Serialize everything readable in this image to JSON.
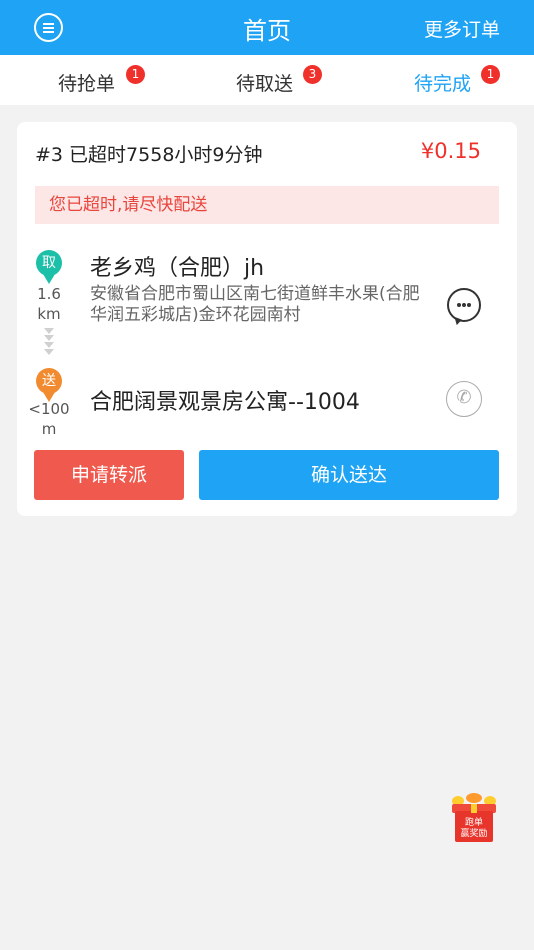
{
  "header": {
    "title": "首页",
    "more_orders": "更多订单"
  },
  "tabs": [
    {
      "label": "待抢单",
      "count": "1"
    },
    {
      "label": "待取送",
      "count": "3"
    },
    {
      "label": "待完成",
      "count": "1"
    }
  ],
  "order": {
    "info": "#3 已超时7558小时9分钟",
    "price": "¥0.15",
    "warning": "您已超时,请尽快配送",
    "pickup": {
      "tag": "取",
      "distance_value": "1.6",
      "distance_unit": "km",
      "name": "老乡鸡（合肥）jh",
      "address": "安徽省合肥市蜀山区南七街道鲜丰水果(合肥华润五彩城店)金环花园南村"
    },
    "delivery": {
      "tag": "送",
      "distance_value": "<100",
      "distance_unit": "m",
      "address": "合肥阔景观景房公寓--1004"
    },
    "actions": {
      "transfer": "申请转派",
      "confirm": "确认送达"
    }
  },
  "reward": {
    "line1": "跑单",
    "line2": "赢奖励"
  },
  "colors": {
    "primary": "#1fa3f5",
    "danger": "#f0302b",
    "pickup": "#1cbfa8",
    "delivery": "#f28b30"
  }
}
